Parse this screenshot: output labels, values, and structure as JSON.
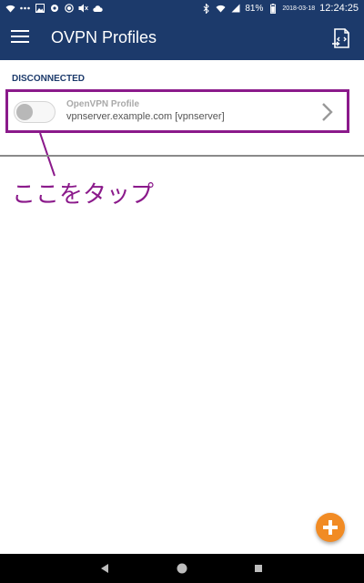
{
  "status_bar": {
    "left_icons": [
      "wifi-icon",
      "dots-icon",
      "image-icon",
      "settings-icon",
      "record-icon",
      "mute-icon",
      "cloud-icon"
    ],
    "right_icons": [
      "bluetooth-icon",
      "wifi-signal-icon",
      "cellular-icon"
    ],
    "battery": "81%",
    "date": "2018-03-18",
    "time": "12:24:25"
  },
  "app_bar": {
    "title": "OVPN Profiles",
    "menu_icon": "hamburger-menu-icon",
    "import_icon": "import-profile-icon"
  },
  "section": {
    "header": "DISCONNECTED"
  },
  "profiles": [
    {
      "name": "OpenVPN Profile",
      "server": "vpnserver.example.com [vpnserver]",
      "connected": false
    }
  ],
  "annotation": {
    "text": "ここをタップ",
    "color": "#8b1a8b"
  },
  "fab": {
    "icon": "plus-icon",
    "color": "#f18b24"
  },
  "nav_bar": {
    "buttons": [
      "back-icon",
      "home-icon",
      "recents-icon"
    ]
  },
  "colors": {
    "primary": "#1c3a6b",
    "annotation": "#8b1a8b",
    "accent": "#f18b24"
  }
}
